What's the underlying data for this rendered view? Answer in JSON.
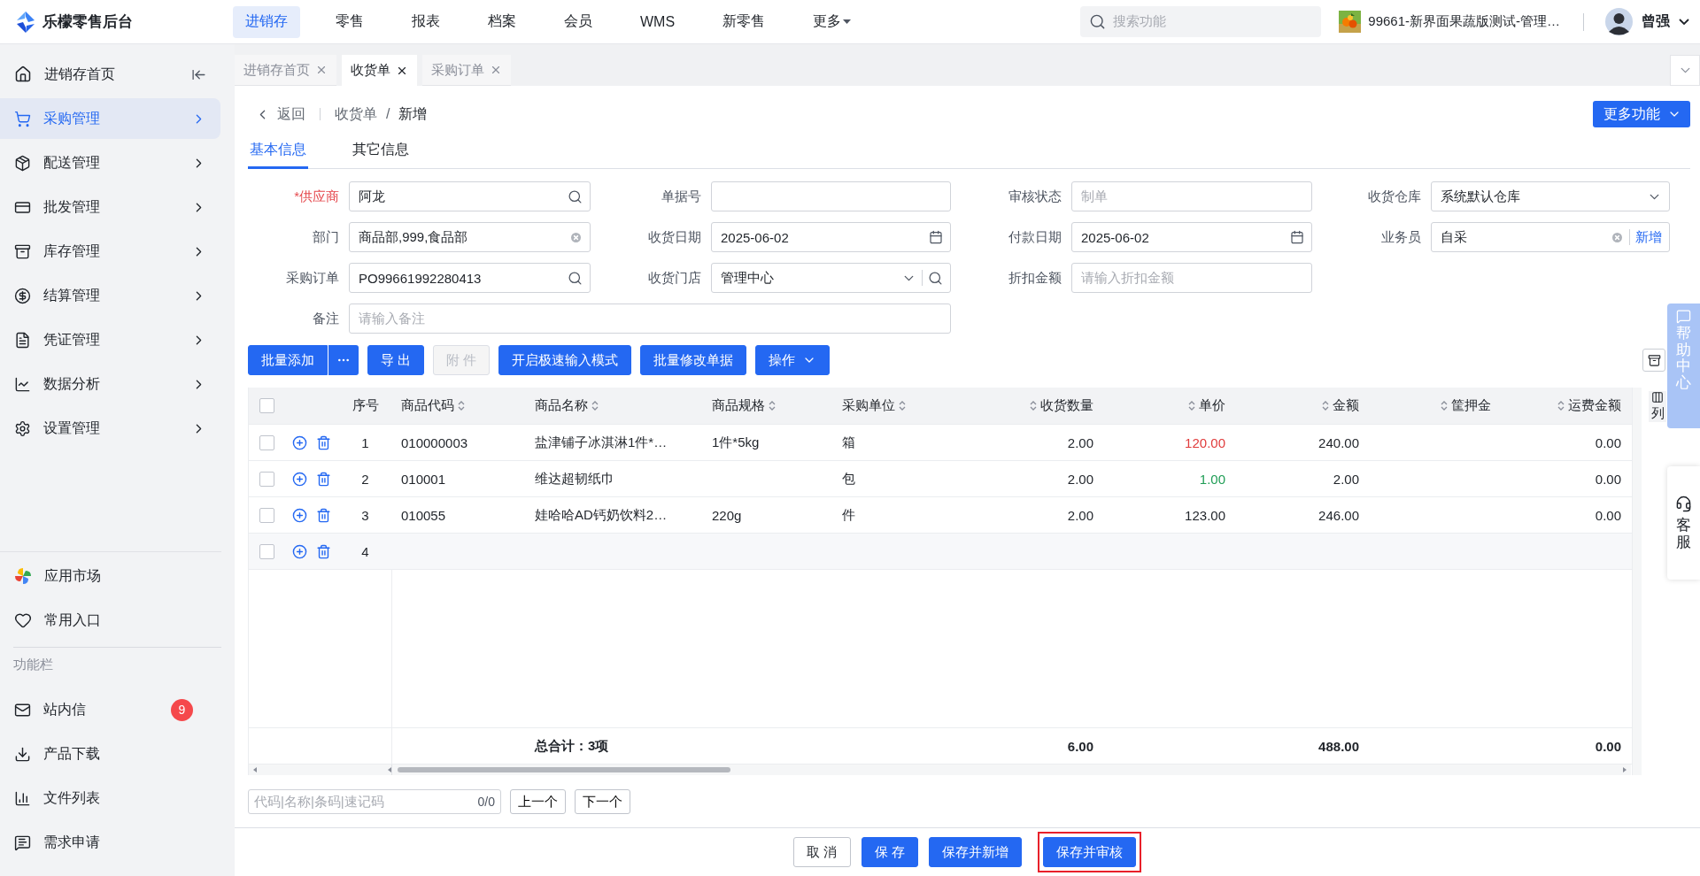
{
  "app": {
    "logo_text": "乐檬零售后台"
  },
  "top_nav": [
    {
      "label": "进销存",
      "selected": true,
      "dropdown": false
    },
    {
      "label": "零售",
      "selected": false,
      "dropdown": false
    },
    {
      "label": "报表",
      "selected": false,
      "dropdown": false
    },
    {
      "label": "档案",
      "selected": false,
      "dropdown": false
    },
    {
      "label": "会员",
      "selected": false,
      "dropdown": false
    },
    {
      "label": "WMS",
      "selected": false,
      "dropdown": false
    },
    {
      "label": "新零售",
      "selected": false,
      "dropdown": false
    },
    {
      "label": "更多",
      "selected": false,
      "dropdown": true
    }
  ],
  "search": {
    "placeholder": "搜索功能"
  },
  "store": {
    "name": "99661-新界面果蔬版测试-管理…"
  },
  "user": {
    "name": "曾强"
  },
  "sidebar": {
    "home": {
      "label": "进销存首页"
    },
    "menu": [
      {
        "label": "采购管理",
        "selected": true
      },
      {
        "label": "配送管理",
        "selected": false
      },
      {
        "label": "批发管理",
        "selected": false
      },
      {
        "label": "库存管理",
        "selected": false
      },
      {
        "label": "结算管理",
        "selected": false
      },
      {
        "label": "凭证管理",
        "selected": false
      },
      {
        "label": "数据分析",
        "selected": false
      },
      {
        "label": "设置管理",
        "selected": false
      }
    ],
    "extras": [
      {
        "label": "应用市场"
      },
      {
        "label": "常用入口"
      }
    ],
    "section_title": "功能栏",
    "tools": [
      {
        "label": "站内信",
        "badge": "9"
      },
      {
        "label": "产品下载"
      },
      {
        "label": "文件列表"
      },
      {
        "label": "需求申请"
      }
    ]
  },
  "page_tabs": [
    {
      "label": "进销存首页",
      "selected": false
    },
    {
      "label": "收货单",
      "selected": true
    },
    {
      "label": "采购订单",
      "selected": false
    }
  ],
  "breadcrumb": {
    "back": "返回",
    "trail": [
      "收货单",
      "新增"
    ],
    "separator": "/"
  },
  "more_button": "更多功能",
  "sub_tabs": [
    {
      "label": "基本信息",
      "selected": true
    },
    {
      "label": "其它信息",
      "selected": false
    }
  ],
  "form": {
    "fields": [
      {
        "label": "*供应商",
        "required": true,
        "kind": "search",
        "value": "阿龙"
      },
      {
        "label": "单据号",
        "required": false,
        "kind": "text"
      },
      {
        "label": "审核状态",
        "required": false,
        "kind": "text",
        "placeholder": "制单"
      },
      {
        "label": "收货仓库",
        "required": false,
        "kind": "select",
        "value": "系统默认仓库"
      },
      {
        "label": "部门",
        "required": false,
        "kind": "clearable",
        "value": "商品部,999,食品部"
      },
      {
        "label": "收货日期",
        "required": false,
        "kind": "date",
        "value": "2025-06-02"
      },
      {
        "label": "付款日期",
        "required": false,
        "kind": "date",
        "value": "2025-06-02"
      },
      {
        "label": "业务员",
        "required": false,
        "kind": "clearable",
        "value": "自采",
        "action": "新增"
      },
      {
        "label": "采购订单",
        "required": false,
        "kind": "search",
        "value": "PO99661992280413"
      },
      {
        "label": "收货门店",
        "required": false,
        "kind": "select-search",
        "value": "管理中心"
      },
      {
        "label": "折扣金额",
        "required": false,
        "kind": "text",
        "placeholder": "请输入折扣金额"
      },
      {
        "label": "备注",
        "required": false,
        "kind": "note",
        "placeholder": "请输入备注"
      }
    ]
  },
  "toolbar": [
    {
      "label": "批量添加",
      "kind": "split",
      "disabled": false
    },
    {
      "label": "导 出",
      "kind": "plain",
      "disabled": false
    },
    {
      "label": "附 件",
      "kind": "plain",
      "disabled": true
    },
    {
      "label": "开启极速输入模式",
      "kind": "plain",
      "disabled": false
    },
    {
      "label": "批量修改单据",
      "kind": "plain",
      "disabled": false
    },
    {
      "label": "操作",
      "kind": "dropdown",
      "disabled": false
    }
  ],
  "table": {
    "header_checked": false,
    "columns": [
      {
        "label": "序号",
        "kind": "index",
        "sortable": false
      },
      {
        "label": "商品代码",
        "kind": "text",
        "sortable": true
      },
      {
        "label": "商品名称",
        "kind": "text",
        "sortable": true
      },
      {
        "label": "商品规格",
        "kind": "text",
        "sortable": true
      },
      {
        "label": "采购单位",
        "kind": "text",
        "sortable": true
      },
      {
        "label": "收货数量",
        "kind": "number",
        "sortable": true
      },
      {
        "label": "单价",
        "kind": "number",
        "sortable": true
      },
      {
        "label": "金额",
        "kind": "number",
        "sortable": true
      },
      {
        "label": "筐押金",
        "kind": "number",
        "sortable": true
      },
      {
        "label": "运费金额",
        "kind": "number",
        "sortable": true
      }
    ],
    "rows": [
      {
        "checked": false,
        "index": "1",
        "code": "010000003",
        "name": "盐津铺子冰淇淋1件*…",
        "spec": "1件*5kg",
        "unit": "箱",
        "quantity": "2.00",
        "price": "120.00",
        "color": "#e03b3b",
        "amount": "240.00",
        "freight": "0.00"
      },
      {
        "checked": false,
        "index": "2",
        "code": "010001",
        "name": "维达超韧纸巾",
        "unit": "包",
        "quantity": "2.00",
        "price": "1.00",
        "color": "#1f9d55",
        "amount": "2.00",
        "freight": "0.00"
      },
      {
        "checked": false,
        "index": "3",
        "code": "010055",
        "name": "娃哈哈AD钙奶饮料2…",
        "spec": "220g",
        "unit": "件",
        "quantity": "2.00",
        "price": "123.00",
        "color": "#1f2329",
        "amount": "246.00",
        "freight": "0.00"
      },
      {
        "checked": false,
        "index": "4"
      }
    ],
    "summary": {
      "label": "总合计：3项",
      "quantity": "6.00",
      "amount": "488.00",
      "freight": "0.00"
    }
  },
  "column_settings": {
    "label": "列"
  },
  "finder": {
    "placeholder": "代码|名称|条码|速记码",
    "count": "0/0",
    "buttons": [
      "上一个",
      "下一个"
    ]
  },
  "footer_buttons": [
    {
      "label": "取 消",
      "kind": "plain",
      "highlighted": false
    },
    {
      "label": "保 存",
      "kind": "primary",
      "highlighted": false
    },
    {
      "label": "保存并新增",
      "kind": "primary",
      "highlighted": false
    },
    {
      "label": "保存并审核",
      "kind": "primary",
      "highlighted": true
    }
  ],
  "help": {
    "label": "帮助中心"
  },
  "service": {
    "label": "客服"
  }
}
